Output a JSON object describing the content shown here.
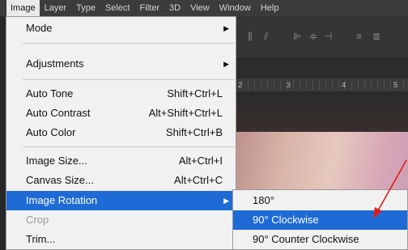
{
  "menubar": {
    "items": [
      "Image",
      "Layer",
      "Type",
      "Select",
      "Filter",
      "3D",
      "View",
      "Window",
      "Help"
    ]
  },
  "image_menu": {
    "mode": "Mode",
    "adjustments": "Adjustments",
    "auto_tone": "Auto Tone",
    "auto_tone_sc": "Shift+Ctrl+L",
    "auto_contrast": "Auto Contrast",
    "auto_contrast_sc": "Alt+Shift+Ctrl+L",
    "auto_color": "Auto Color",
    "auto_color_sc": "Shift+Ctrl+B",
    "image_size": "Image Size...",
    "image_size_sc": "Alt+Ctrl+I",
    "canvas_size": "Canvas Size...",
    "canvas_size_sc": "Alt+Ctrl+C",
    "image_rotation": "Image Rotation",
    "crop": "Crop",
    "trim": "Trim..."
  },
  "rotation_submenu": {
    "items": [
      "180°",
      "90° Clockwise",
      "90° Counter Clockwise"
    ],
    "highlighted": "90° Clockwise"
  },
  "ruler": {
    "ticks": [
      "2",
      "3",
      "4",
      "5"
    ]
  },
  "colors": {
    "highlight": "#1e6bd6",
    "annotation_arrow": "#e01b1b"
  }
}
